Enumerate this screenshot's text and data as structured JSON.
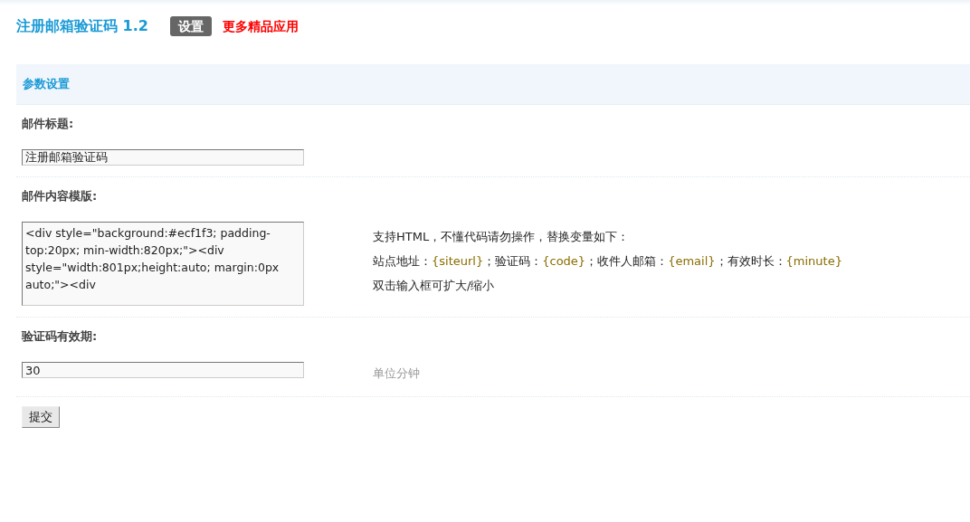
{
  "header": {
    "title": "注册邮箱验证码 1.2",
    "tabs": [
      {
        "label": "设置",
        "selected": true
      },
      {
        "label": "更多精品应用",
        "selected": false
      }
    ]
  },
  "section": {
    "title": "参数设置"
  },
  "fields": [
    {
      "kind": "input",
      "label": "邮件标题:",
      "value": "注册邮箱验证码"
    },
    {
      "kind": "textarea",
      "label": "邮件内容模版:",
      "value": "<div style=\"background:#ecf1f3; padding-top:20px; min-width:820px;\"><div style=\"width:801px;height:auto; margin:0px auto;\"><div",
      "hint_lines": [
        [
          {
            "kind": "text",
            "text": "支持HTML，不懂代码请勿操作，替换变量如下："
          }
        ],
        [
          {
            "kind": "text",
            "text": "站点地址："
          },
          {
            "kind": "var",
            "text": "{siteurl}"
          },
          {
            "kind": "text",
            "text": "；验证码："
          },
          {
            "kind": "var",
            "text": "{code}"
          },
          {
            "kind": "text",
            "text": "；收件人邮箱："
          },
          {
            "kind": "var",
            "text": "{email}"
          },
          {
            "kind": "text",
            "text": "；有效时长："
          },
          {
            "kind": "var",
            "text": "{minute}"
          }
        ],
        [
          {
            "kind": "text",
            "text": "双击输入框可扩大/缩小"
          }
        ]
      ]
    },
    {
      "kind": "input",
      "label": "验证码有效期:",
      "value": "30",
      "note": "单位分钟"
    }
  ],
  "submit": "提交"
}
